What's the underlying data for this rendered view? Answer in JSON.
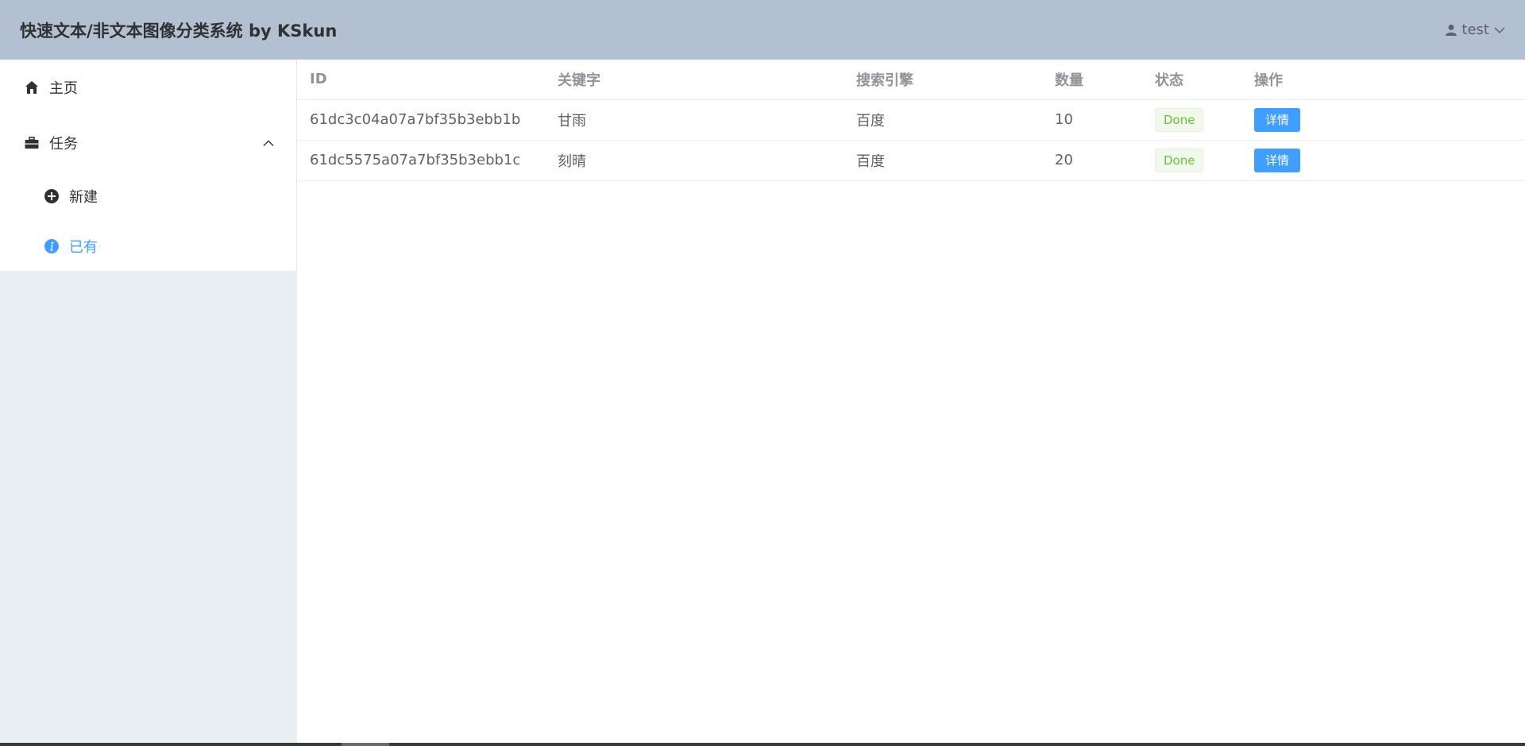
{
  "header": {
    "title": "快速文本/非文本图像分类系统 by KSkun",
    "user": "test"
  },
  "sidebar": {
    "home_label": "主页",
    "tasks_label": "任务",
    "new_label": "新建",
    "existing_label": "已有"
  },
  "table": {
    "headers": [
      "ID",
      "关键字",
      "搜索引擎",
      "数量",
      "状态",
      "操作"
    ],
    "rows": [
      {
        "id": "61dc3c04a07a7bf35b3ebb1b",
        "keyword": "甘雨",
        "engine": "百度",
        "count": "10",
        "status": "Done",
        "action": "详情"
      },
      {
        "id": "61dc5575a07a7bf35b3ebb1c",
        "keyword": "刻晴",
        "engine": "百度",
        "count": "20",
        "status": "Done",
        "action": "详情"
      }
    ]
  },
  "colors": {
    "header_bg": "#b3c0d1",
    "aside_bg": "#e9eef3",
    "accent": "#409eff",
    "success": "#67c23a"
  }
}
